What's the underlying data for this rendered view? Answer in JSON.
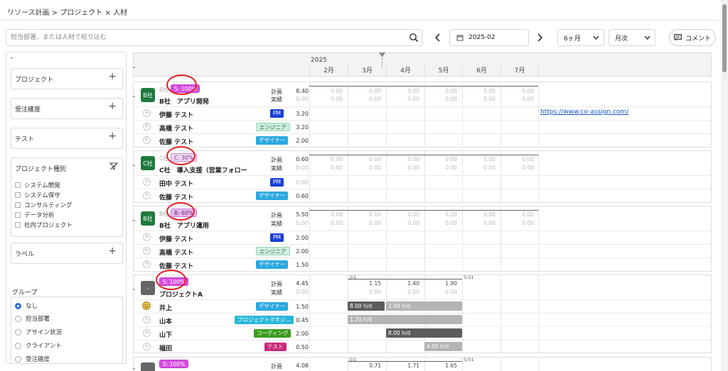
{
  "breadcrumb": "リソース計画 > プロジェクト × 人材",
  "search": {
    "placeholder": "担当部署、または人材で絞り込む"
  },
  "date": "2025-02",
  "period": "6ヶ月",
  "granularity": "月次",
  "comment_label": "コメント",
  "sidebar": {
    "filters": [
      {
        "label": "プロジェクト"
      },
      {
        "label": "受注確度"
      },
      {
        "label": "テスト"
      }
    ],
    "project_type": {
      "title": "プロジェクト種別",
      "options": [
        "システム開発",
        "システム保守",
        "コンサルティング",
        "データ分析",
        "社内プロジェクト"
      ]
    },
    "label_filter": "ラベル",
    "group": {
      "title": "グループ",
      "options": [
        "なし",
        "担当部署",
        "アサイン状況",
        "クライアント",
        "受注確度"
      ]
    }
  },
  "grid": {
    "year": "2025",
    "months": [
      "2月",
      "3月",
      "4月",
      "5月",
      "6月",
      "7月"
    ]
  },
  "labels": {
    "plan": "計画",
    "actual": "実績"
  },
  "zero": "0.00",
  "link": "https://www.co-assign.com/",
  "projects": [
    {
      "client_icon": "B社",
      "client_dim": "B社",
      "badge": "S: 100%",
      "name": "B社　アプリ開発",
      "plan_total": "8.40",
      "actual_total": "0.00",
      "members": [
        {
          "name": "伊藤 テスト",
          "role": "PM",
          "value": "3.20"
        },
        {
          "name": "高橋 テスト",
          "role": "エンジニア",
          "value": "3.20"
        },
        {
          "name": "佐藤 テスト",
          "role": "デザイナー",
          "value": "2.00"
        }
      ]
    },
    {
      "client_icon": "C社",
      "client_dim": "C社",
      "badge": "C: 30%",
      "name": "C社　導入支援（営業フォロー",
      "plan_total": "0.60",
      "actual_total": "0.00",
      "members": [
        {
          "name": "田中 テスト",
          "role": "PM",
          "value": "0.00"
        },
        {
          "name": "佐藤 テスト",
          "role": "デザイナー",
          "value": "0.60"
        }
      ]
    },
    {
      "client_icon": "B社",
      "client_dim": "B社",
      "badge": "B: 60%",
      "name": "B社　アプリ運用",
      "plan_total": "5.50",
      "actual_total": "0.00",
      "members": [
        {
          "name": "伊藤 テスト",
          "role": "PM",
          "value": "2.00"
        },
        {
          "name": "高橋 テスト",
          "role": "エンジニア",
          "value": "2.00"
        },
        {
          "name": "佐藤 テスト",
          "role": "デザイナー",
          "value": "1.50"
        }
      ]
    },
    {
      "client_icon": "-",
      "badge": "S: 100%",
      "name": "プロジェクトA",
      "plan_total": "4.45",
      "actual_total": "0.00",
      "range_start": "3/1",
      "range_end": "5/31",
      "monthly_plan": [
        "1.15",
        "1.40",
        "1.90"
      ],
      "members": [
        {
          "name": "井上",
          "role": "デザイナー",
          "value": "1.50",
          "bars": [
            {
              "label": "8.00 h/d"
            },
            {
              "label": "2.00 h/d"
            }
          ]
        },
        {
          "name": "山本",
          "role": "プロジェクトマネジ…",
          "value": "0.45",
          "bars": [
            {
              "label": "1.20 h/d"
            }
          ]
        },
        {
          "name": "山下",
          "role": "コーディング",
          "value": "2.00",
          "bars": [
            {
              "label": "8.00 h/d"
            }
          ]
        },
        {
          "name": "福田",
          "role": "テスト",
          "value": "0.50",
          "bars": [
            {
              "label": "4.00 h/d"
            }
          ]
        }
      ]
    },
    {
      "badge": "S: 100%",
      "plan_total": "4.08",
      "range_start": "3/1",
      "range_end": "5/31",
      "monthly_plan": [
        "0.71",
        "1.71",
        "1.65"
      ]
    }
  ]
}
